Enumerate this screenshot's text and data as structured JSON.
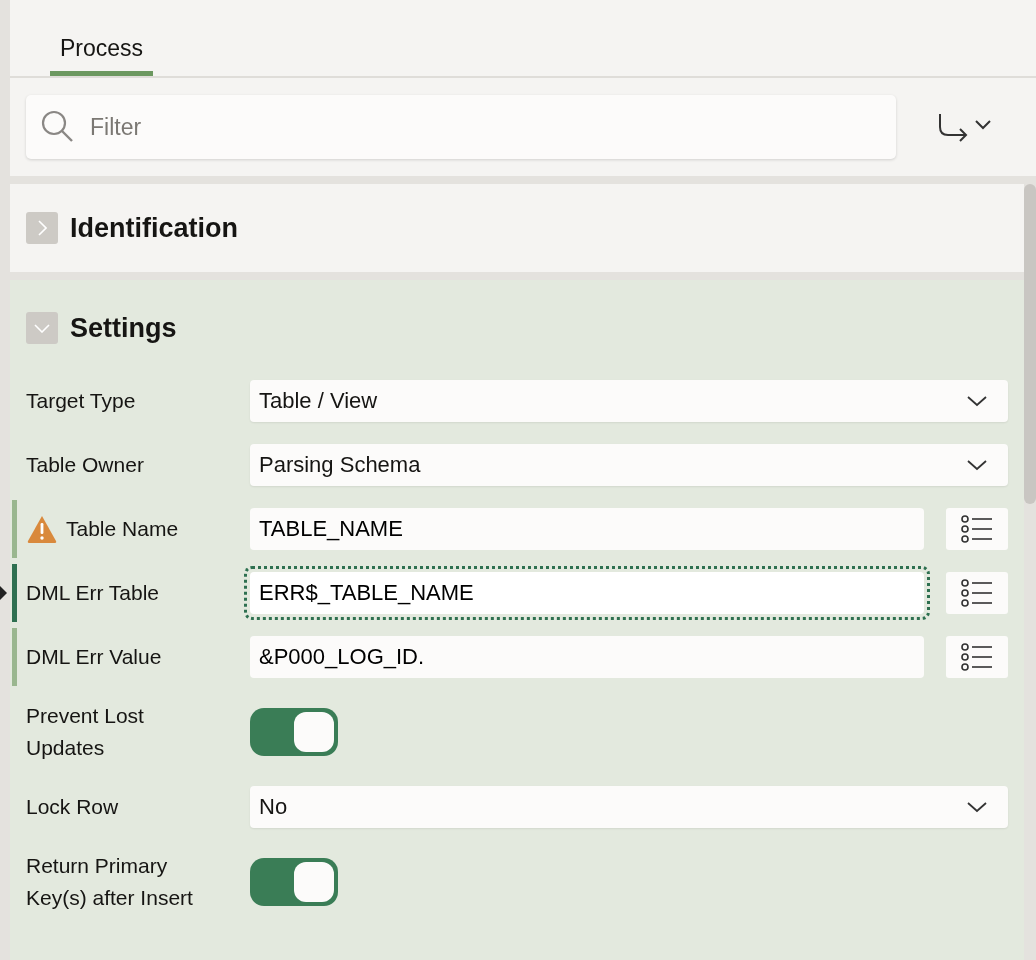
{
  "tabs": [
    {
      "label": "Process",
      "selected": true
    }
  ],
  "filter": {
    "placeholder": "Filter"
  },
  "sections": [
    {
      "title": "Identification",
      "expanded": false
    },
    {
      "title": "Settings",
      "expanded": true,
      "fields": [
        {
          "label": "Target Type",
          "kind": "select",
          "value": "Table / View",
          "changed": false,
          "current": false,
          "warning": false
        },
        {
          "label": "Table Owner",
          "kind": "select",
          "value": "Parsing Schema",
          "changed": false,
          "current": false,
          "warning": false
        },
        {
          "label": "Table Name",
          "kind": "text",
          "value": "TABLE_NAME",
          "changed": true,
          "current": false,
          "warning": true,
          "focused": false
        },
        {
          "label": "DML Err Table",
          "kind": "text",
          "value": "ERR$_TABLE_NAME",
          "changed": true,
          "current": true,
          "warning": false,
          "focused": true
        },
        {
          "label": "DML Err Value",
          "kind": "text",
          "value": "&P000_LOG_ID.",
          "changed": true,
          "current": false,
          "warning": false,
          "focused": false
        },
        {
          "label": "Prevent Lost Updates",
          "kind": "toggle",
          "on": true,
          "changed": false,
          "current": false,
          "warning": false
        },
        {
          "label": "Lock Row",
          "kind": "select",
          "value": "No",
          "changed": false,
          "current": false,
          "warning": false
        },
        {
          "label": "Return Primary Key(s) after Insert",
          "kind": "toggle",
          "on": true,
          "changed": false,
          "current": false,
          "warning": false
        }
      ]
    }
  ]
}
